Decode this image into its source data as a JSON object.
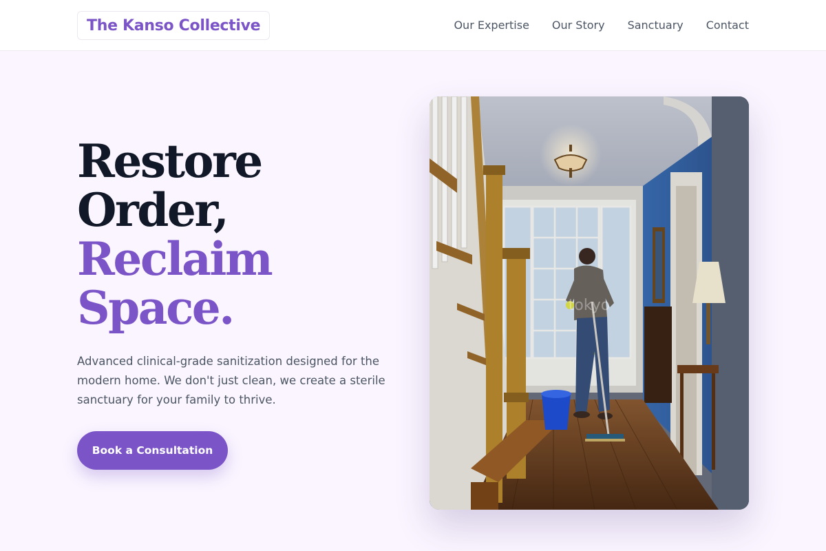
{
  "brand": {
    "name": "The Kanso Collective",
    "accent_color": "#7b55c7",
    "background_color": "#faf5ff"
  },
  "nav": {
    "items": [
      {
        "label": "Our Expertise"
      },
      {
        "label": "Our Story"
      },
      {
        "label": "Sanctuary"
      },
      {
        "label": "Contact"
      }
    ]
  },
  "hero": {
    "headline_lines": [
      "Restore",
      "Order,",
      "Reclaim",
      "Space."
    ],
    "description": "Advanced clinical-grade sanitization designed for the modern home. We don't just clean, we create a sterile sanctuary for your family to thrive.",
    "cta_label": "Book a Consultation",
    "image_watermark": "tokyo"
  }
}
